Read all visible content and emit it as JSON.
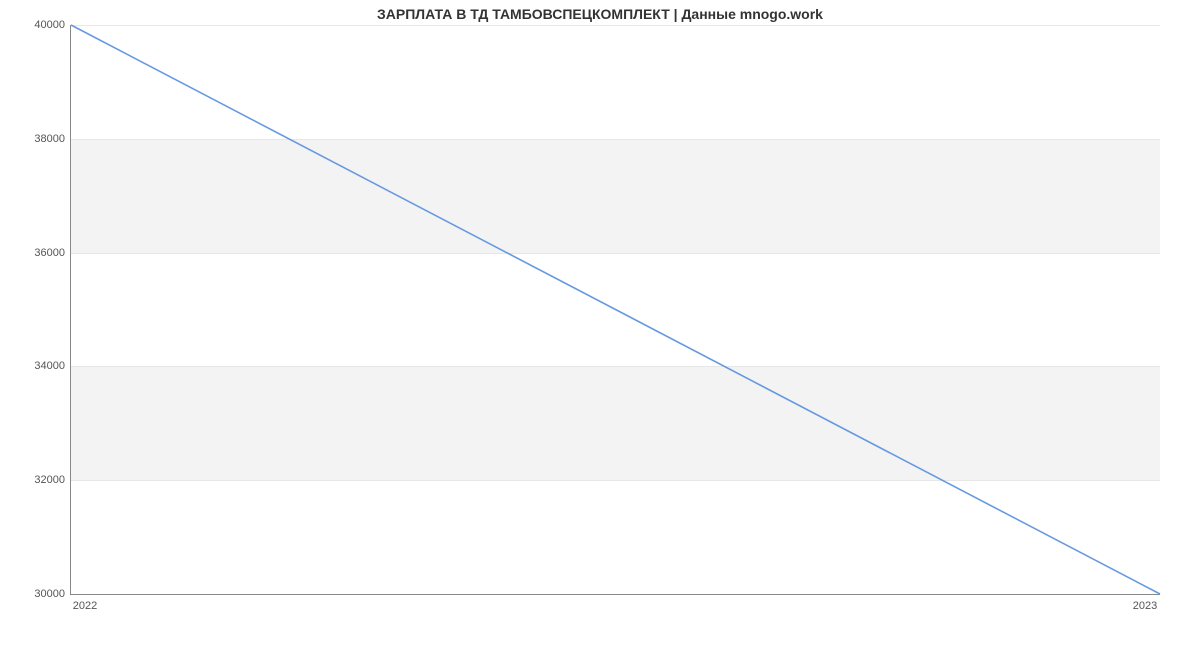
{
  "chart_data": {
    "type": "line",
    "title": "ЗАРПЛАТА В ТД ТАМБОВСПЕЦКОМПЛЕКТ | Данные mnogo.work",
    "xlabel": "",
    "ylabel": "",
    "x": [
      "2022",
      "2023"
    ],
    "y": [
      40000,
      30000
    ],
    "xlim": [
      "2022",
      "2023"
    ],
    "ylim": [
      30000,
      40000
    ],
    "yticks": [
      30000,
      32000,
      34000,
      36000,
      38000,
      40000
    ],
    "xticks": [
      "2022",
      "2023"
    ],
    "line_color": "#6699e0",
    "band_color": "#f3f3f3"
  }
}
